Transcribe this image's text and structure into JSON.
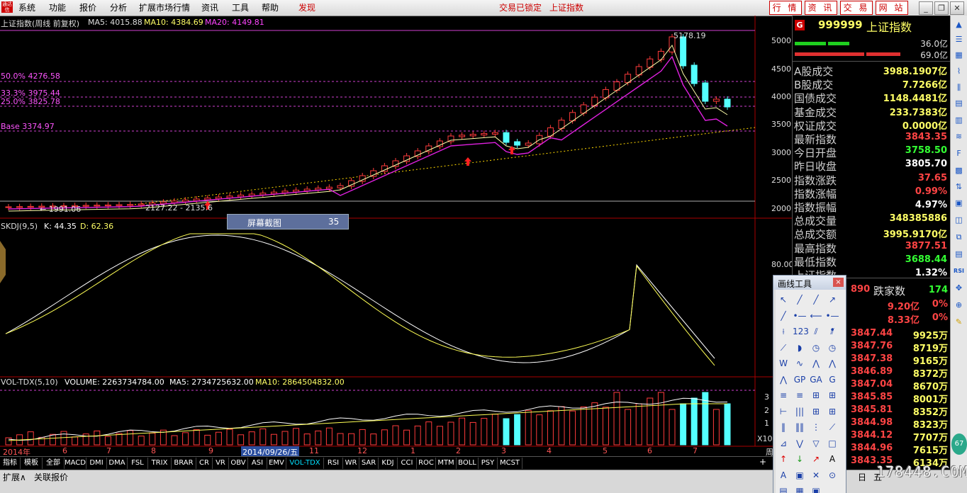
{
  "menu": {
    "items": [
      "系统",
      "功能",
      "报价",
      "分析",
      "扩展市场行情",
      "资讯",
      "工具",
      "帮助"
    ],
    "discover": "发现",
    "lock_status": "交易已锁定",
    "current_index": "上证指数",
    "right_buttons": [
      "行 情",
      "资 讯",
      "交 易",
      "网 站"
    ],
    "logo": "通达信"
  },
  "chart": {
    "title": "上证指数(周线 前复权)",
    "ma5_label": "MA5: 4015.88",
    "ma10_label": "MA10: 4384.69",
    "ma20_label": "MA20: 4149.81",
    "high_label": "5178.19",
    "fib_50": "50.0% 4276.58",
    "fib_333": "33.3% 3975.44",
    "fib_25": "25.0% 3825.78",
    "fib_base": "Base 3374.97",
    "low_label_1": "1991.06",
    "low_label_2": "2127.22 - 2135.6",
    "price_axis": [
      "5000",
      "4500",
      "4000",
      "3500",
      "3000",
      "2500",
      "2000"
    ],
    "skdj_title": "SKDJ(9,5)",
    "skdj_k": "K: 44.35",
    "skdj_d": "D: 62.36",
    "skdj_axis": [
      "80.00"
    ],
    "vol_title": "VOL-TDX(5,10)",
    "vol_volume": "VOLUME: 2263734784.00",
    "vol_ma5": "MA5: 2734725632.00",
    "vol_ma10": "MA10: 2864504832.00",
    "vol_axis": [
      "3",
      "2",
      "1"
    ],
    "vol_unit": "X10",
    "date_axis": [
      "2014年",
      "6",
      "7",
      "8",
      "9",
      "2014/09/26/五",
      "11",
      "12",
      "1",
      "2",
      "3",
      "4",
      "5",
      "6",
      "7"
    ],
    "popup_label": "屏幕截图",
    "popup_value": "35",
    "corner_label": "周"
  },
  "right_panel": {
    "badge": "G",
    "code": "999999",
    "name": "上证指数",
    "buy_amount": "36.0亿",
    "sell_amount": "69.0亿",
    "rows": [
      {
        "label": "A股成交",
        "value": "3988.1907亿",
        "color": "#ffff66"
      },
      {
        "label": "B股成交",
        "value": "7.7266亿",
        "color": "#ffff66"
      },
      {
        "label": "国债成交",
        "value": "1148.4481亿",
        "color": "#ffff66"
      },
      {
        "label": "基金成交",
        "value": "233.7383亿",
        "color": "#ffff66"
      },
      {
        "label": "权证成交",
        "value": "0.0000亿",
        "color": "#ffff66"
      },
      {
        "label": "最新指数",
        "value": "3843.35",
        "color": "#ff4444"
      },
      {
        "label": "今日开盘",
        "value": "3758.50",
        "color": "#33ff33"
      },
      {
        "label": "昨日收盘",
        "value": "3805.70",
        "color": "#ffffff"
      },
      {
        "label": "指数涨跌",
        "value": "37.65",
        "color": "#ff4444"
      },
      {
        "label": "指数涨幅",
        "value": "0.99%",
        "color": "#ff4444"
      },
      {
        "label": "指数振幅",
        "value": "4.97%",
        "color": "#ffffff"
      },
      {
        "label": "总成交量",
        "value": "348385886",
        "color": "#ffff66"
      },
      {
        "label": "总成交额",
        "value": "3995.9170亿",
        "color": "#ffff66"
      },
      {
        "label": "最高指数",
        "value": "3877.51",
        "color": "#ff4444"
      },
      {
        "label": "最低指数",
        "value": "3688.44",
        "color": "#33ff33"
      },
      {
        "label": "上证指数",
        "value": "1.32%",
        "color": "#ffffff"
      }
    ],
    "fall_count_label": "跌家数",
    "fall_prefix": "890",
    "fall_count": "174",
    "amounts": [
      {
        "value": "9.20亿",
        "pct": "0%"
      },
      {
        "value": "8.33亿",
        "pct": "0%"
      }
    ],
    "ticks": [
      {
        "price": "3847.44",
        "vol": "9925万"
      },
      {
        "price": "3847.76",
        "vol": "8719万"
      },
      {
        "price": "3847.38",
        "vol": "9165万"
      },
      {
        "price": "3846.89",
        "vol": "8372万"
      },
      {
        "price": "3847.04",
        "vol": "8670万"
      },
      {
        "price": "3845.85",
        "vol": "8001万"
      },
      {
        "price": "3845.81",
        "vol": "8352万"
      },
      {
        "price": "3844.98",
        "vol": "8323万"
      },
      {
        "price": "3844.12",
        "vol": "7707万"
      },
      {
        "price": "3844.96",
        "vol": "7615万"
      },
      {
        "price": "3843.35",
        "vol": "6134万"
      }
    ],
    "bottom_tabs": [
      "日",
      "五"
    ]
  },
  "tabs": [
    "指标",
    "模板",
    "全部",
    "MACD",
    "DMI",
    "DMA",
    "FSL",
    "TRIX",
    "BRAR",
    "CR",
    "VR",
    "OBV",
    "ASI",
    "EMV",
    "VOL-TDX",
    "RSI",
    "WR",
    "SAR",
    "KDJ",
    "CCI",
    "ROC",
    "MTM",
    "BOLL",
    "PSY",
    "MCST"
  ],
  "active_tab": "VOL-TDX",
  "bottom": {
    "expand": "扩展∧",
    "related": "关联报价",
    "plus": "+"
  },
  "draw_tool": {
    "title": "画线工具",
    "close": "×",
    "tools": [
      "↖",
      "╱",
      "╱",
      "↗",
      "╱",
      "•—",
      "⟵",
      "•—•",
      "⟊",
      "123",
      "⫽",
      "⫽",
      "⟋",
      "◗",
      "◷",
      "◷",
      "W",
      "∿",
      "⋀",
      "⋀",
      "⋀",
      "GP",
      "GA",
      "G",
      "≡",
      "≡",
      "⊞",
      "⊞",
      "⊢",
      "|||",
      "⊞",
      "⊞",
      "‖",
      "‖‖",
      "⋮",
      "⟋",
      "⊿",
      "⋁",
      "▽",
      "□",
      "↑",
      "↓",
      "↗",
      "A",
      "A",
      "▣",
      "✕",
      "⊙",
      "▤",
      "▦",
      "▣"
    ]
  },
  "watermark": "178448.COM"
}
